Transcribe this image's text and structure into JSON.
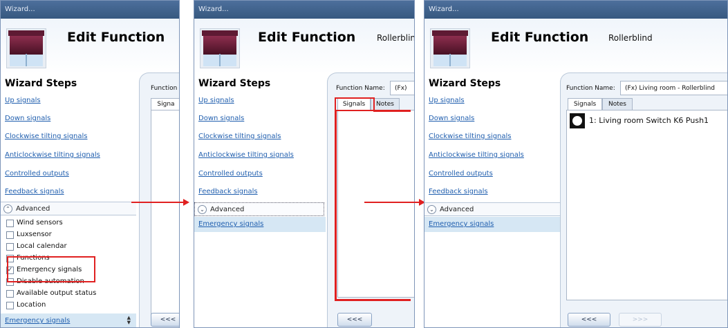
{
  "window_title": "Wizard...",
  "header": {
    "title": "Edit Function",
    "subtitle": "Rollerblind"
  },
  "wizard_steps": {
    "title": "Wizard Steps",
    "items": [
      "Up signals",
      "Down signals",
      "Clockwise tilting signals",
      "Anticlockwise tilting signals",
      "Controlled outputs",
      "Feedback signals"
    ]
  },
  "advanced": {
    "label": "Advanced",
    "options": [
      {
        "label": "Wind sensors",
        "checked": false
      },
      {
        "label": "Luxsensor",
        "checked": false
      },
      {
        "label": "Local calendar",
        "checked": false
      },
      {
        "label": "Functions",
        "checked": false
      },
      {
        "label": "Emergency signals",
        "checked": true
      },
      {
        "label": "Disable automation",
        "checked": false
      },
      {
        "label": "Available output status",
        "checked": false
      },
      {
        "label": "Location",
        "checked": false
      }
    ]
  },
  "emergency_step": "Emergency signals",
  "panel1": {
    "function_label_partial": "Function",
    "tab_partial": "Signa",
    "back_button": "<<<"
  },
  "panel2": {
    "function_label": "Function Name:",
    "function_value_partial": "(Fx)",
    "tabs": [
      "Signals",
      "Notes"
    ],
    "back_button": "<<<"
  },
  "panel3": {
    "function_label": "Function Name:",
    "function_value": "(Fx) Living room - Rollerblind",
    "tabs": [
      "Signals",
      "Notes"
    ],
    "signal_item": "1: Living room Switch K6 Push1",
    "back_button": "<<<",
    "next_button": ">>>"
  },
  "colors": {
    "annotation_red": "#e02020",
    "titlebar": "#3f628c",
    "link_blue": "#1f5eae",
    "selected_step": "#d6e7f4"
  },
  "icons": {
    "blind": "rollerblind-icon",
    "expand": "chevron-up-icon",
    "collapse": "chevron-down-icon",
    "signal": "push-button-icon",
    "scroll": "scroll-arrows-icon"
  }
}
